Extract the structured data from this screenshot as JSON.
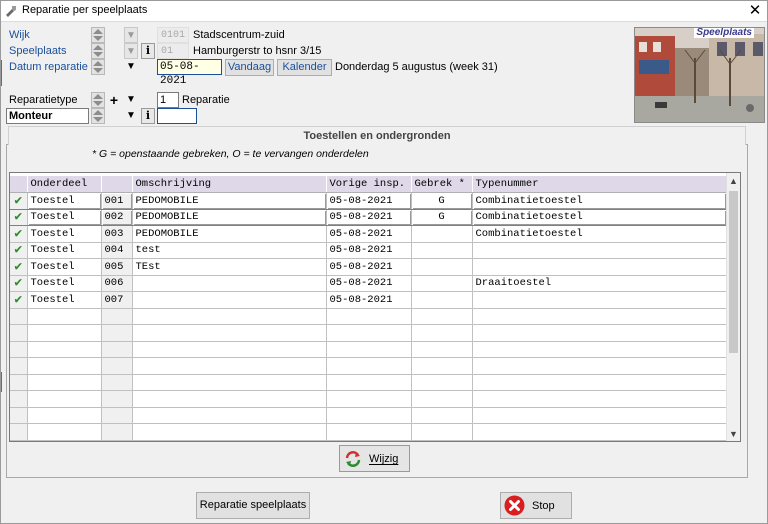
{
  "window": {
    "title": "Reparatie per speelplaats",
    "close_glyph": "✕"
  },
  "form": {
    "wijk": {
      "label": "Wijk",
      "code": "0101",
      "name": "Stadscentrum-zuid"
    },
    "speelplaats": {
      "label": "Speelplaats",
      "code": "01",
      "name": "Hamburgerstr to hsnr 3/15"
    },
    "datum": {
      "label": "Datum reparatie",
      "value": "05-08-2021",
      "vandaag_label": "Vandaag",
      "kalender_label": "Kalender",
      "description": "Donderdag  5 augustus (week 31)"
    },
    "reparatietype": {
      "label": "Reparatietype",
      "code": "1",
      "name": "Reparatie"
    },
    "monteur": {
      "value": "Monteur",
      "code": ""
    }
  },
  "photo": {
    "caption": "Speelplaats"
  },
  "tab": {
    "title": "Toestellen en ondergronden",
    "note": "* G = openstaande gebreken, O = te vervangen onderdelen"
  },
  "grid": {
    "columns": [
      "",
      "Onderdeel",
      "",
      "Omschrijving",
      "Vorige insp.",
      "Gebrek *",
      "Typenummer"
    ],
    "rows": [
      {
        "checked": true,
        "onderdeel": "Toestel",
        "num": "001",
        "omschrijving": "PEDOMOBILE",
        "vorige": "05-08-2021",
        "gebrek": "G",
        "type": "Combinatietoestel"
      },
      {
        "checked": true,
        "onderdeel": "Toestel",
        "num": "002",
        "omschrijving": "PEDOMOBILE",
        "vorige": "05-08-2021",
        "gebrek": "G",
        "type": "Combinatietoestel"
      },
      {
        "checked": true,
        "onderdeel": "Toestel",
        "num": "003",
        "omschrijving": "PEDOMOBILE",
        "vorige": "05-08-2021",
        "gebrek": "",
        "type": "Combinatietoestel"
      },
      {
        "checked": true,
        "onderdeel": "Toestel",
        "num": "004",
        "omschrijving": "test",
        "vorige": "05-08-2021",
        "gebrek": "",
        "type": ""
      },
      {
        "checked": true,
        "onderdeel": "Toestel",
        "num": "005",
        "omschrijving": "TEst",
        "vorige": "05-08-2021",
        "gebrek": "",
        "type": ""
      },
      {
        "checked": true,
        "onderdeel": "Toestel",
        "num": "006",
        "omschrijving": "",
        "vorige": "05-08-2021",
        "gebrek": "",
        "type": "Draaitoestel"
      },
      {
        "checked": true,
        "onderdeel": "Toestel",
        "num": "007",
        "omschrijving": "",
        "vorige": "05-08-2021",
        "gebrek": "",
        "type": ""
      }
    ],
    "empty_rows": 8,
    "check_glyph": "✔"
  },
  "buttons": {
    "wijzig": "Wijzig",
    "reparatie_speelplaats": "Reparatie speelplaats",
    "stop": "Stop"
  },
  "colors": {
    "accent": "#1a4f9c",
    "header_bg": "#ded8e8",
    "check": "#2e8b2e",
    "stop": "#d81e1e"
  }
}
